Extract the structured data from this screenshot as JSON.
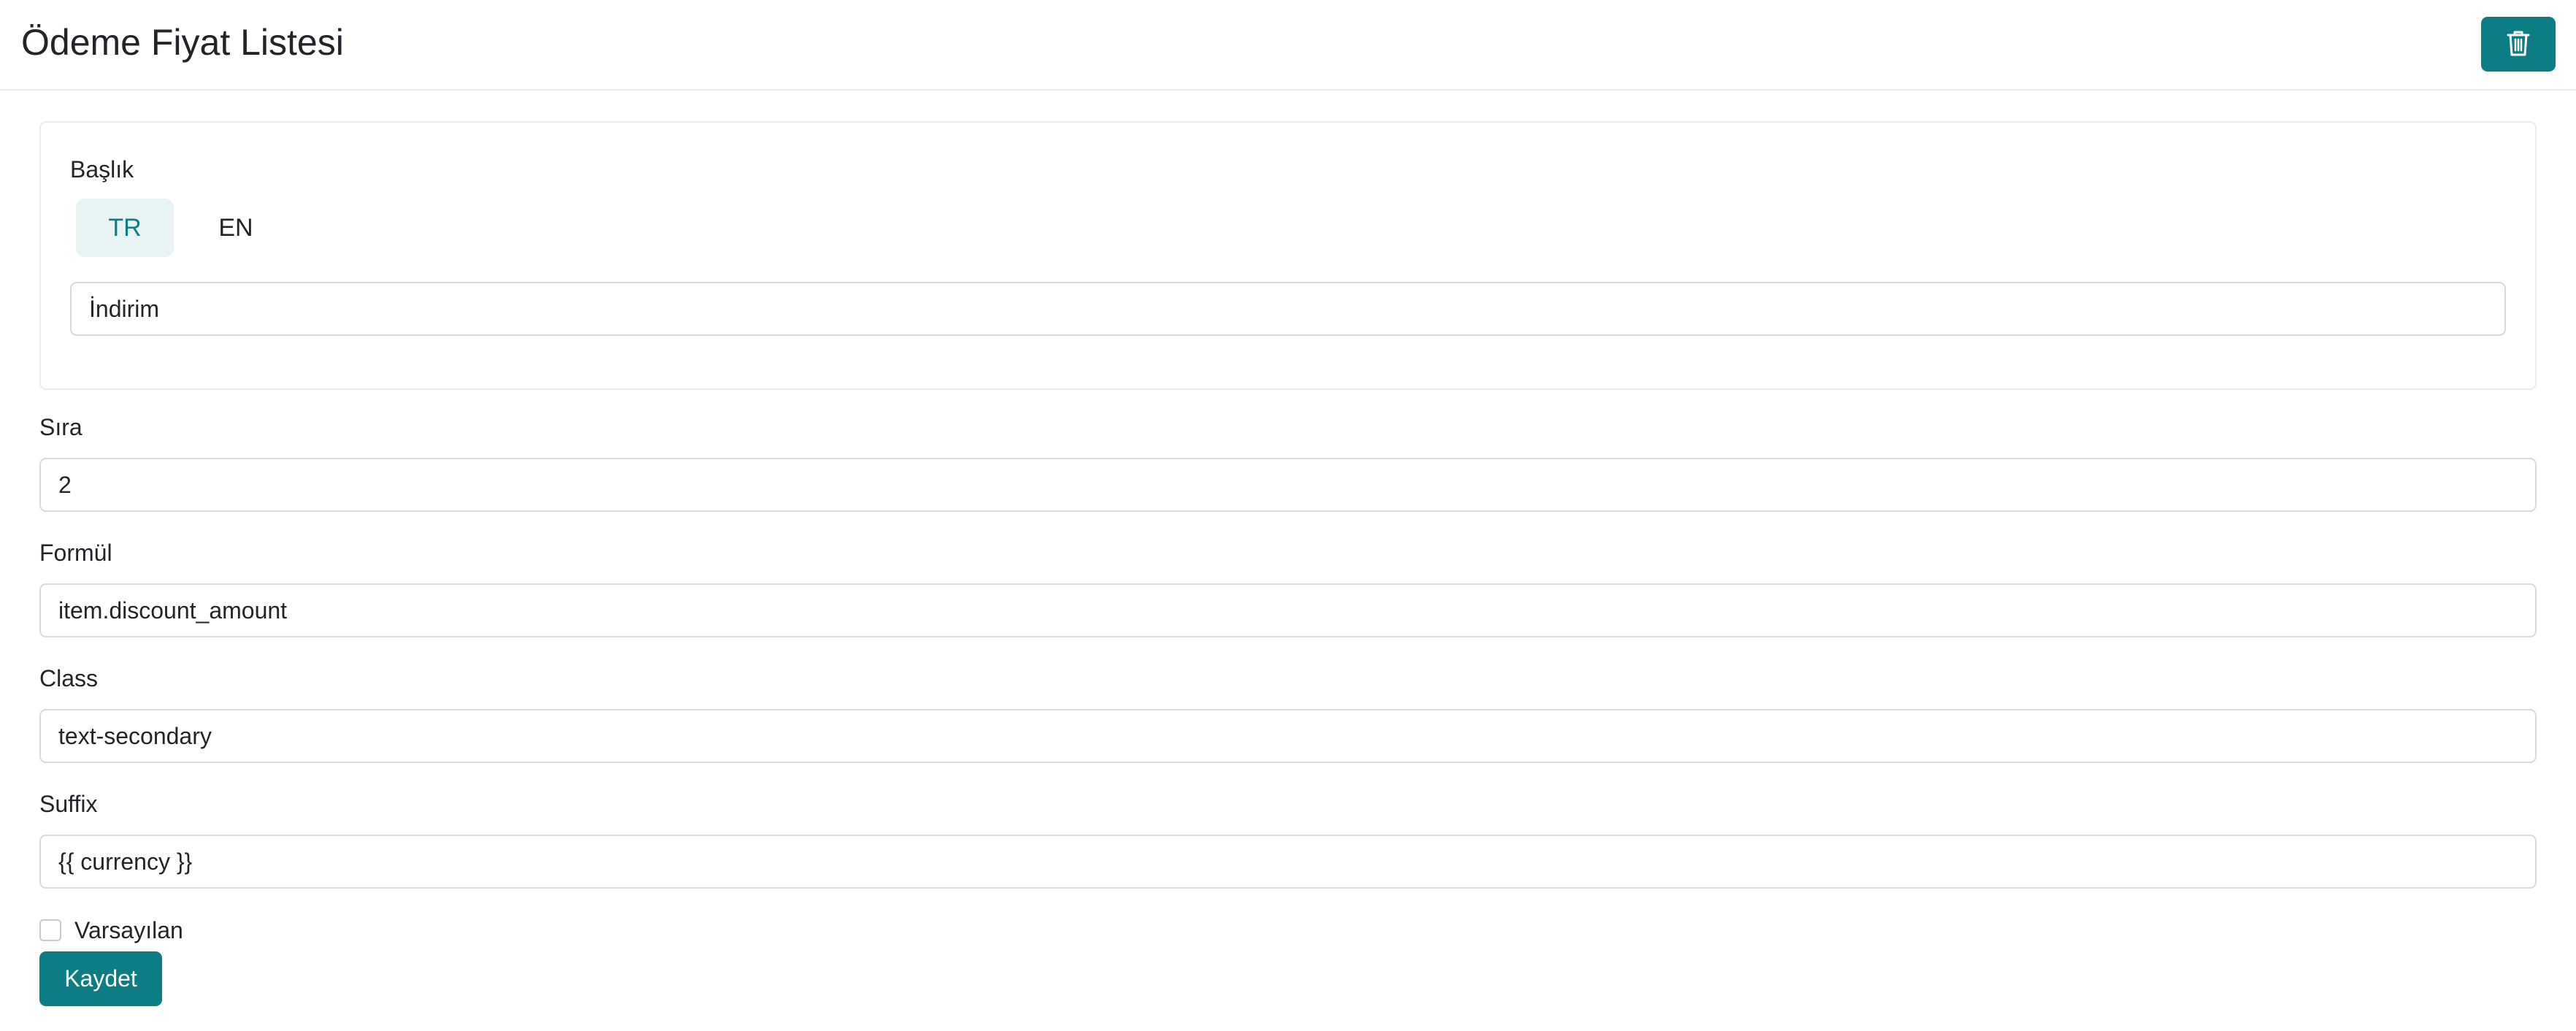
{
  "header": {
    "title": "Ödeme Fiyat Listesi",
    "delete_icon": "trash-icon",
    "accent_color": "#0d7d85"
  },
  "title_section": {
    "label": "Başlık",
    "tabs": [
      {
        "label": "TR",
        "active": true
      },
      {
        "label": "EN",
        "active": false
      }
    ],
    "value": "İndirim"
  },
  "fields": {
    "sira": {
      "label": "Sıra",
      "value": "2"
    },
    "formul": {
      "label": "Formül",
      "value": "item.discount_amount"
    },
    "class": {
      "label": "Class",
      "value": "text-secondary"
    },
    "suffix": {
      "label": "Suffix",
      "value": "{{ currency }}"
    }
  },
  "default_checkbox": {
    "label": "Varsayılan",
    "checked": false
  },
  "save_button": {
    "label": "Kaydet"
  }
}
